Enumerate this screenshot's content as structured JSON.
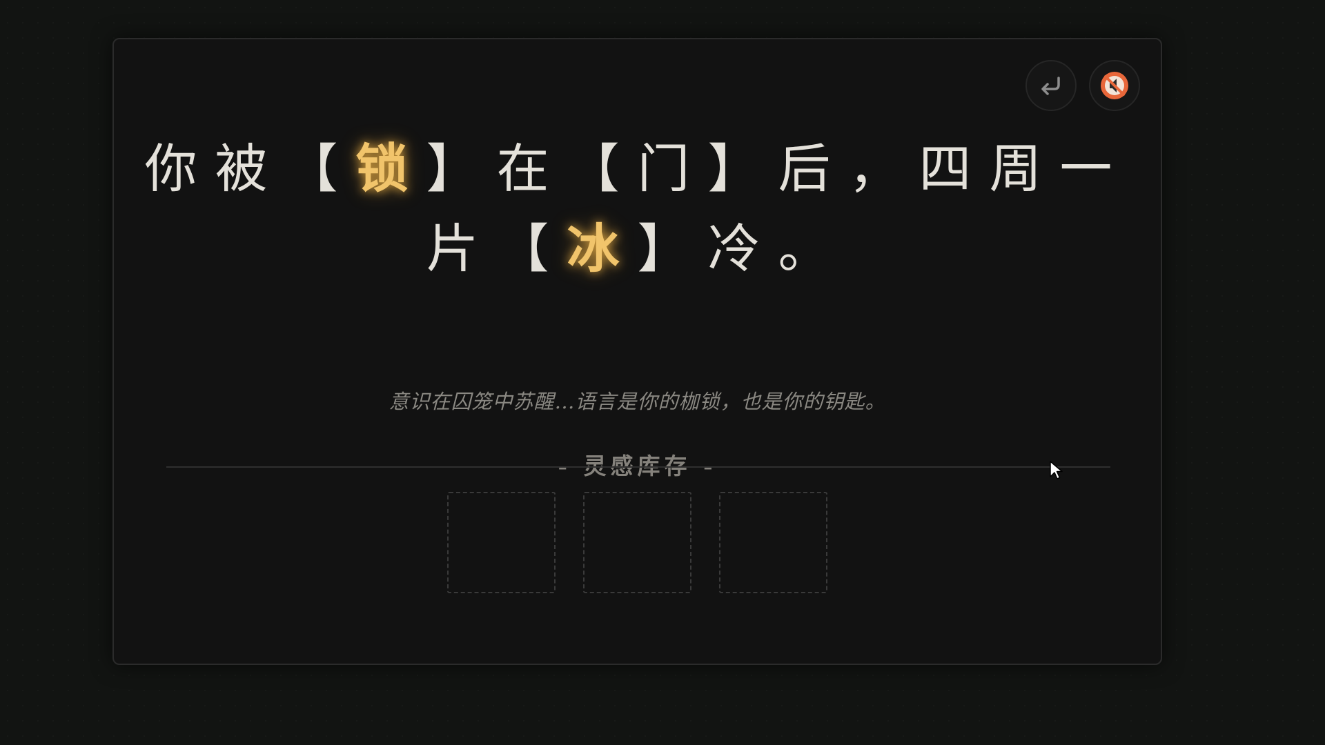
{
  "sentence": {
    "line1": {
      "t1": "你被【",
      "kw1": "锁",
      "t2": "】在【门】后，四周一"
    },
    "line2": {
      "t1": "片【",
      "kw2": "冰",
      "t2": "】冷。"
    }
  },
  "subtitle": "意识在囚笼中苏醒…语言是你的枷锁，也是你的钥匙。",
  "inventory": {
    "title": "- 灵感库存 -",
    "slots": [
      "",
      "",
      ""
    ]
  },
  "controls": {
    "undo_icon": "undo-arrow-icon",
    "mute_icon": "muted-speaker-icon"
  },
  "colors": {
    "keyword": "#f1c46b",
    "text": "#e4e1da",
    "mute_accent": "#e8673a"
  }
}
